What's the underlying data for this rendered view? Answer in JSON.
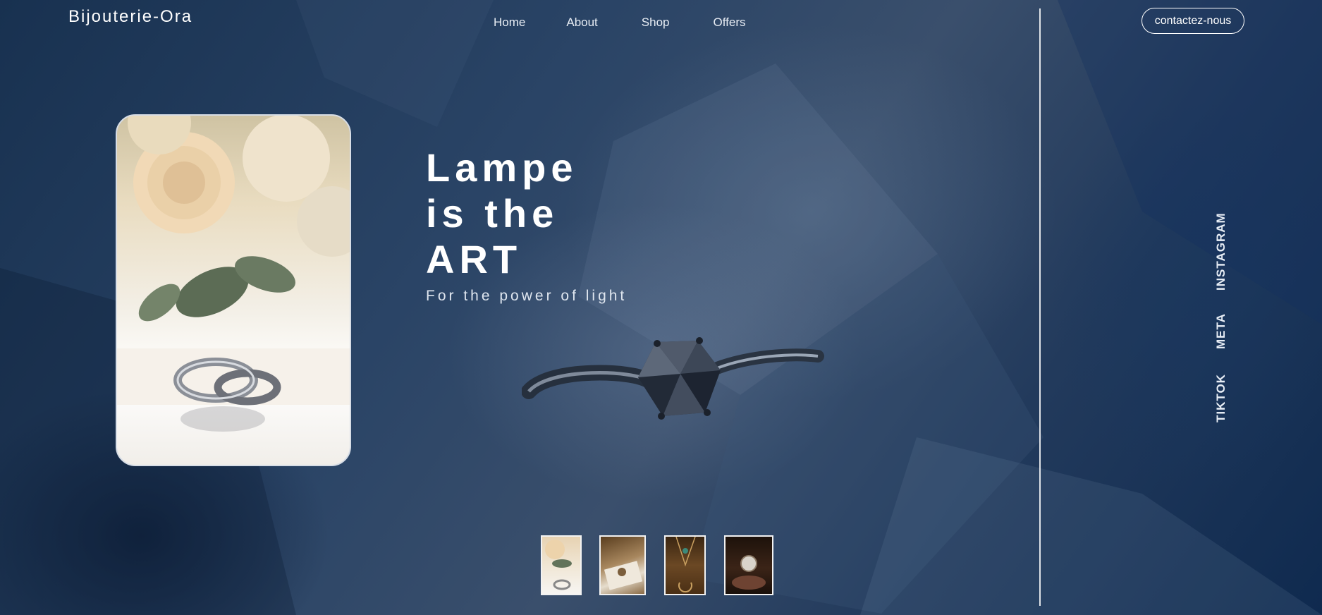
{
  "brand": "Bijouterie-Ora",
  "nav": {
    "items": [
      "Home",
      "About",
      "Shop",
      "Offers"
    ]
  },
  "contact_button": "contactez-nous",
  "hero": {
    "line1": "Lampe",
    "line2": "is the",
    "line3": "ART",
    "tagline": "For the power of light"
  },
  "social": [
    "INSTAGRAM",
    "META",
    "TIKTOK"
  ],
  "images": {
    "feature": "wedding-rings-roses-photo",
    "product": "diamond-ring-photo",
    "thumbnails": [
      "roses-rings-thumb",
      "book-jewelry-thumb",
      "pendant-necklace-thumb",
      "pocket-watch-thumb"
    ]
  },
  "colors": {
    "background": "#1f3350",
    "text": "#ffffff",
    "divider": "#ffffff"
  }
}
